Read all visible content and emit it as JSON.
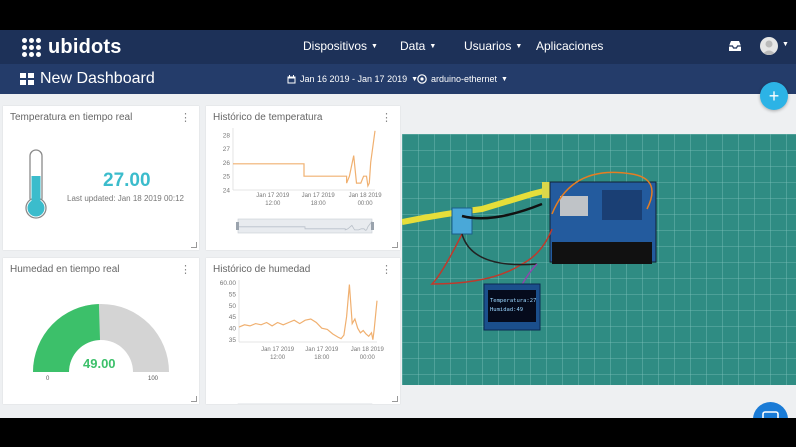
{
  "brand": {
    "name": "ubidots"
  },
  "nav": {
    "dispositivos": "Dispositivos",
    "data": "Data",
    "usuarios": "Usuarios",
    "aplicaciones": "Aplicaciones"
  },
  "subbar": {
    "title": "New Dashboard",
    "date_range": "Jan 16 2019 - Jan 17 2019",
    "device": "arduino-ethernet"
  },
  "widgets": {
    "temp_realtime": {
      "title": "Temperatura en tiempo real",
      "value": "27.00",
      "last_updated": "Last updated: Jan 18 2019 00:12"
    },
    "temp_history": {
      "title": "Histórico de temperatura"
    },
    "hum_realtime": {
      "title": "Humedad en tiempo real",
      "value": "49.00",
      "min_label": "0",
      "max_label": "100"
    },
    "hum_history": {
      "title": "Histórico de humedad"
    }
  },
  "oled": {
    "line1": "Temperatura:27",
    "line2": "Humidad:49"
  },
  "icons": [
    "logo-dots-icon",
    "caret-down-icon",
    "tray-icon",
    "avatar-icon",
    "dashboard-grid-icon",
    "calendar-icon",
    "device-icon",
    "plus-icon",
    "thermometer-icon",
    "kebab-icon",
    "chat-icon"
  ],
  "colors": {
    "navy": "#1d3158",
    "subnav": "#243c6a",
    "accent": "#2cb3e6",
    "value": "#3bbccc",
    "line": "#f0b070",
    "gauge": "#3cc06a",
    "gauge_bg": "#d4d4d4"
  },
  "gauge_fraction": 0.49,
  "chart_data": [
    {
      "type": "line",
      "title": "Histórico de temperatura",
      "yticks": [
        "28",
        "27",
        "26",
        "25",
        "24"
      ],
      "ylim": [
        24,
        28.5
      ],
      "xticks": [
        {
          "date": "Jan 17 2019",
          "time": "12:00"
        },
        {
          "date": "Jan 17 2019",
          "time": "18:00"
        },
        {
          "date": "Jan 18 2019",
          "time": "00:00"
        }
      ],
      "x": [
        0,
        0.05,
        0.1,
        0.15,
        0.2,
        0.25,
        0.3,
        0.35,
        0.4,
        0.45,
        0.5,
        0.5,
        0.55,
        0.6,
        0.65,
        0.7,
        0.75,
        0.8,
        0.8,
        0.82,
        0.85,
        0.87,
        0.9,
        0.92,
        0.94,
        0.95,
        0.96,
        0.97,
        1.0
      ],
      "y": [
        25.9,
        25.9,
        25.9,
        25.9,
        25.9,
        25.9,
        25.9,
        25.9,
        25.9,
        25.9,
        25.9,
        25.0,
        25.0,
        25.0,
        25.0,
        25.0,
        25.0,
        25.0,
        24.5,
        25.0,
        26.5,
        24.5,
        24.5,
        25.0,
        25.0,
        24.3,
        24.5,
        26.0,
        28.3
      ]
    },
    {
      "type": "line",
      "title": "Histórico de humedad",
      "yticks": [
        "60.00",
        "55",
        "50",
        "45",
        "40",
        "35"
      ],
      "ylim": [
        34,
        61
      ],
      "xticks": [
        {
          "date": "Jan 17 2019",
          "time": "12:00"
        },
        {
          "date": "Jan 17 2019",
          "time": "18:00"
        },
        {
          "date": "Jan 18 2019",
          "time": "00:00"
        }
      ],
      "x": [
        0,
        0.04,
        0.08,
        0.12,
        0.16,
        0.2,
        0.24,
        0.28,
        0.32,
        0.36,
        0.4,
        0.44,
        0.48,
        0.52,
        0.56,
        0.6,
        0.64,
        0.68,
        0.72,
        0.74,
        0.76,
        0.78,
        0.8,
        0.82,
        0.84,
        0.86,
        0.88,
        0.9,
        0.92,
        0.94,
        0.96,
        0.97,
        0.98,
        1.0
      ],
      "y": [
        40.5,
        41.5,
        41.0,
        42.0,
        41.5,
        42.5,
        41.0,
        42.5,
        41.5,
        42.5,
        43.5,
        42.0,
        43.5,
        44.0,
        42.5,
        40.0,
        39.5,
        37.5,
        36.0,
        35.5,
        37.0,
        45.0,
        59.0,
        42.0,
        44.0,
        40.0,
        38.0,
        39.0,
        37.5,
        36.5,
        38.0,
        35.0,
        39.5,
        52.0
      ]
    }
  ]
}
